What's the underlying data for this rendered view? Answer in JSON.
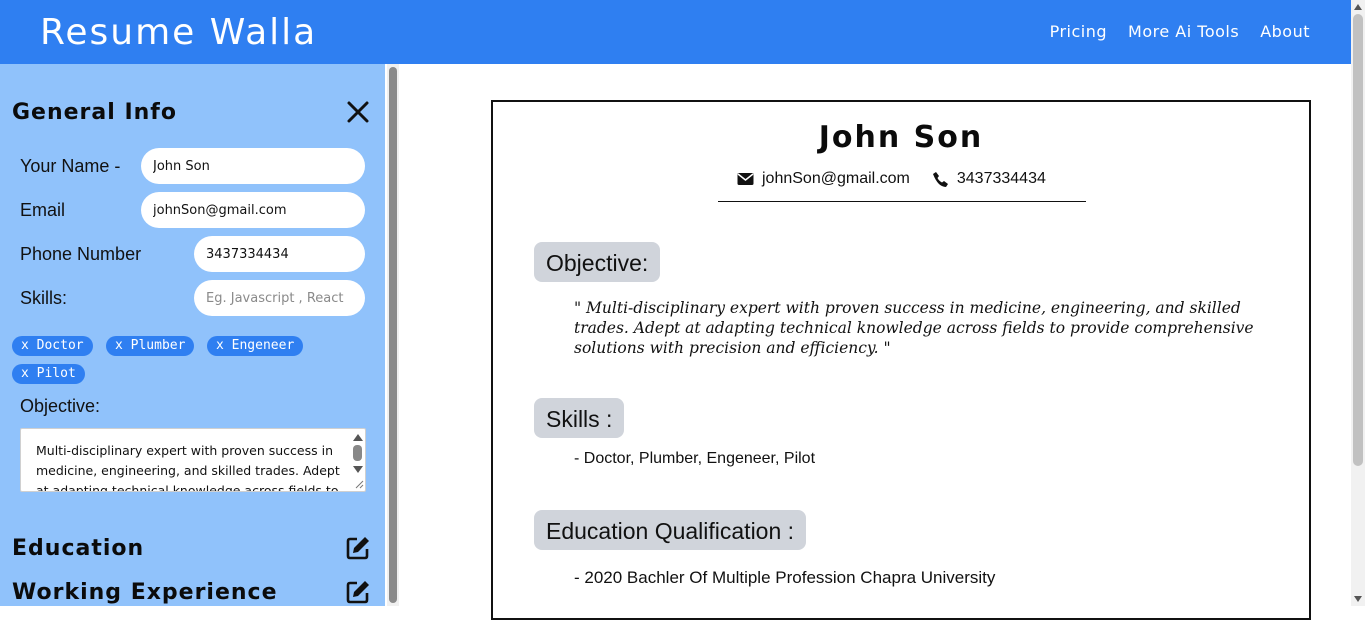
{
  "header": {
    "brand": "Resume Walla",
    "nav": [
      "Pricing",
      "More Ai Tools",
      "About"
    ]
  },
  "sidebar": {
    "general_title": "General Info",
    "labels": {
      "name": "Your Name -",
      "email": "Email",
      "phone": "Phone Number",
      "skills": "Skills:",
      "objective": "Objective:"
    },
    "inputs": {
      "name": "John Son",
      "email": "johnSon@gmail.com",
      "phone": "3437334434",
      "skills_placeholder": "Eg. Javascript , React"
    },
    "chips": [
      "x Doctor",
      "x Plumber",
      "x Engeneer",
      "x Pilot"
    ],
    "objective_text": "Multi-disciplinary expert with proven success in medicine, engineering, and skilled trades. Adept at adapting technical knowledge across fields to provide comprehensive solutions with precision and efficiency.",
    "education_title": "Education",
    "experience_title": "Working Experience"
  },
  "resume": {
    "name": "John Son",
    "email": "johnSon@gmail.com",
    "phone": "3437334434",
    "objective_heading": "Objective:",
    "objective_text": "\" Multi-disciplinary expert with proven success in medicine, engineering, and skilled trades. Adept at adapting technical knowledge across fields to provide comprehensive solutions with precision and efficiency. \"",
    "skills_heading": "Skills :",
    "skills_line": "-  Doctor, Plumber, Engeneer, Pilot",
    "education_heading": "Education Qualification :",
    "education_line": "- 2020 Bachler Of Multiple Profession Chapra University"
  },
  "icons": {
    "close": "close-icon",
    "edit": "edit-icon",
    "mail": "envelope-icon",
    "phone": "phone-icon"
  },
  "colors": {
    "header_bg": "#2f7ff1",
    "sidebar_bg": "#90c2fb",
    "chip_bg": "#2f7ff1",
    "pill_bg": "#d0d4db"
  }
}
